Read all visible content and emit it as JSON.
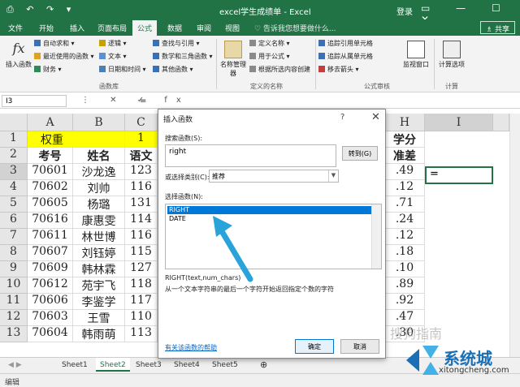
{
  "titlebar": {
    "quick_access": "⎙ ↶ ↷ ▾",
    "title": "excel学生成绩单 - Excel",
    "login": "登录",
    "window_buttons": "▭ — ☐ ✕"
  },
  "tabs": [
    "文件",
    "开始",
    "插入",
    "页面布局",
    "公式",
    "数据",
    "审阅",
    "视图"
  ],
  "active_tab": "公式",
  "tellme": "♡ 告诉我您想要做什么...",
  "share": "♗ 共享",
  "ribbon": {
    "insert_function": "插入函数",
    "library": {
      "col1": [
        "自动求和 ▾",
        "最近使用的函数 ▾",
        "财务 ▾"
      ],
      "col2": [
        "逻辑 ▾",
        "文本 ▾",
        "日期和时间 ▾"
      ],
      "col3": [
        "查找与引用 ▾",
        "数学和三角函数 ▾",
        "其他函数 ▾"
      ],
      "label": "函数库"
    },
    "names": {
      "manager": "名称管理器",
      "items": [
        "定义名称 ▾",
        "用于公式 ▾",
        "根据所选内容创建"
      ],
      "label": "定义的名称"
    },
    "audit": {
      "items": [
        "追踪引用单元格",
        "追踪从属单元格",
        "移去箭头 ▾"
      ],
      "watch": "监视窗口",
      "label": "公式审核"
    },
    "calc": {
      "options": "计算选项",
      "label": "计算"
    }
  },
  "formula_bar": {
    "namebox": "I3",
    "buttons": "⋮ ✕ ✓ fx",
    "content": "="
  },
  "columns": [
    "A",
    "B",
    "C",
    "H",
    "I"
  ],
  "rows": [
    "1",
    "2",
    "3",
    "4",
    "5",
    "6",
    "7",
    "8",
    "9",
    "10",
    "11",
    "12",
    "13"
  ],
  "cells": {
    "a1": "权重",
    "c1": "1",
    "h1": "学分",
    "a2": "考号",
    "b2": "姓名",
    "c2": "语文",
    "h2": "准差",
    "i3": "=",
    "data": [
      {
        "id": "70601",
        "name": "沙龙逸",
        "c": "123",
        "h": ".49"
      },
      {
        "id": "70602",
        "name": "刘帅",
        "c": "116",
        "h": ".12"
      },
      {
        "id": "70605",
        "name": "杨璐",
        "c": "131",
        "h": ".71"
      },
      {
        "id": "70616",
        "name": "康惠雯",
        "c": "114",
        "h": ".24"
      },
      {
        "id": "70611",
        "name": "林世博",
        "c": "116",
        "h": ".12"
      },
      {
        "id": "70607",
        "name": "刘钰婷",
        "c": "115",
        "h": ".18"
      },
      {
        "id": "70609",
        "name": "韩林霖",
        "c": "127",
        "h": ".10"
      },
      {
        "id": "70612",
        "name": "苑宇飞",
        "c": "118",
        "h": ".89"
      },
      {
        "id": "70606",
        "name": "李鉴学",
        "c": "117",
        "h": ".92"
      },
      {
        "id": "70603",
        "name": "王雪",
        "c": "110",
        "h": ".47"
      },
      {
        "id": "70604",
        "name": "韩雨萌",
        "c": "113",
        "h": ".30"
      }
    ]
  },
  "sheets": [
    "Sheet1",
    "Sheet2",
    "Sheet3",
    "Sheet4",
    "Sheet5",
    "⊕"
  ],
  "active_sheet": "Sheet2",
  "status": "编辑",
  "dialog": {
    "title": "插入函数",
    "help": "?",
    "close": "✕",
    "search_label": "搜索函数(S):",
    "search_value": "right",
    "go": "转到(G)",
    "category_label": "或选择类别(C):",
    "category_value": "推荐",
    "select_label": "选择函数(N):",
    "functions": [
      "RIGHT",
      "DATE"
    ],
    "syntax": "RIGHT(text,num_chars)",
    "description": "从一个文本字符串的最后一个字符开始返回指定个数的字符",
    "help_link": "有关该函数的帮助",
    "ok": "确定",
    "cancel": "取消"
  },
  "watermarks": {
    "sogou": "搜狗指南",
    "brand": "系统城",
    "url": "xitongcheng.com"
  },
  "colors": {
    "excel_green": "#217346",
    "highlight_yellow": "#ffff00",
    "selection_blue": "#0078d7",
    "arrow_blue": "#29a3d9"
  }
}
